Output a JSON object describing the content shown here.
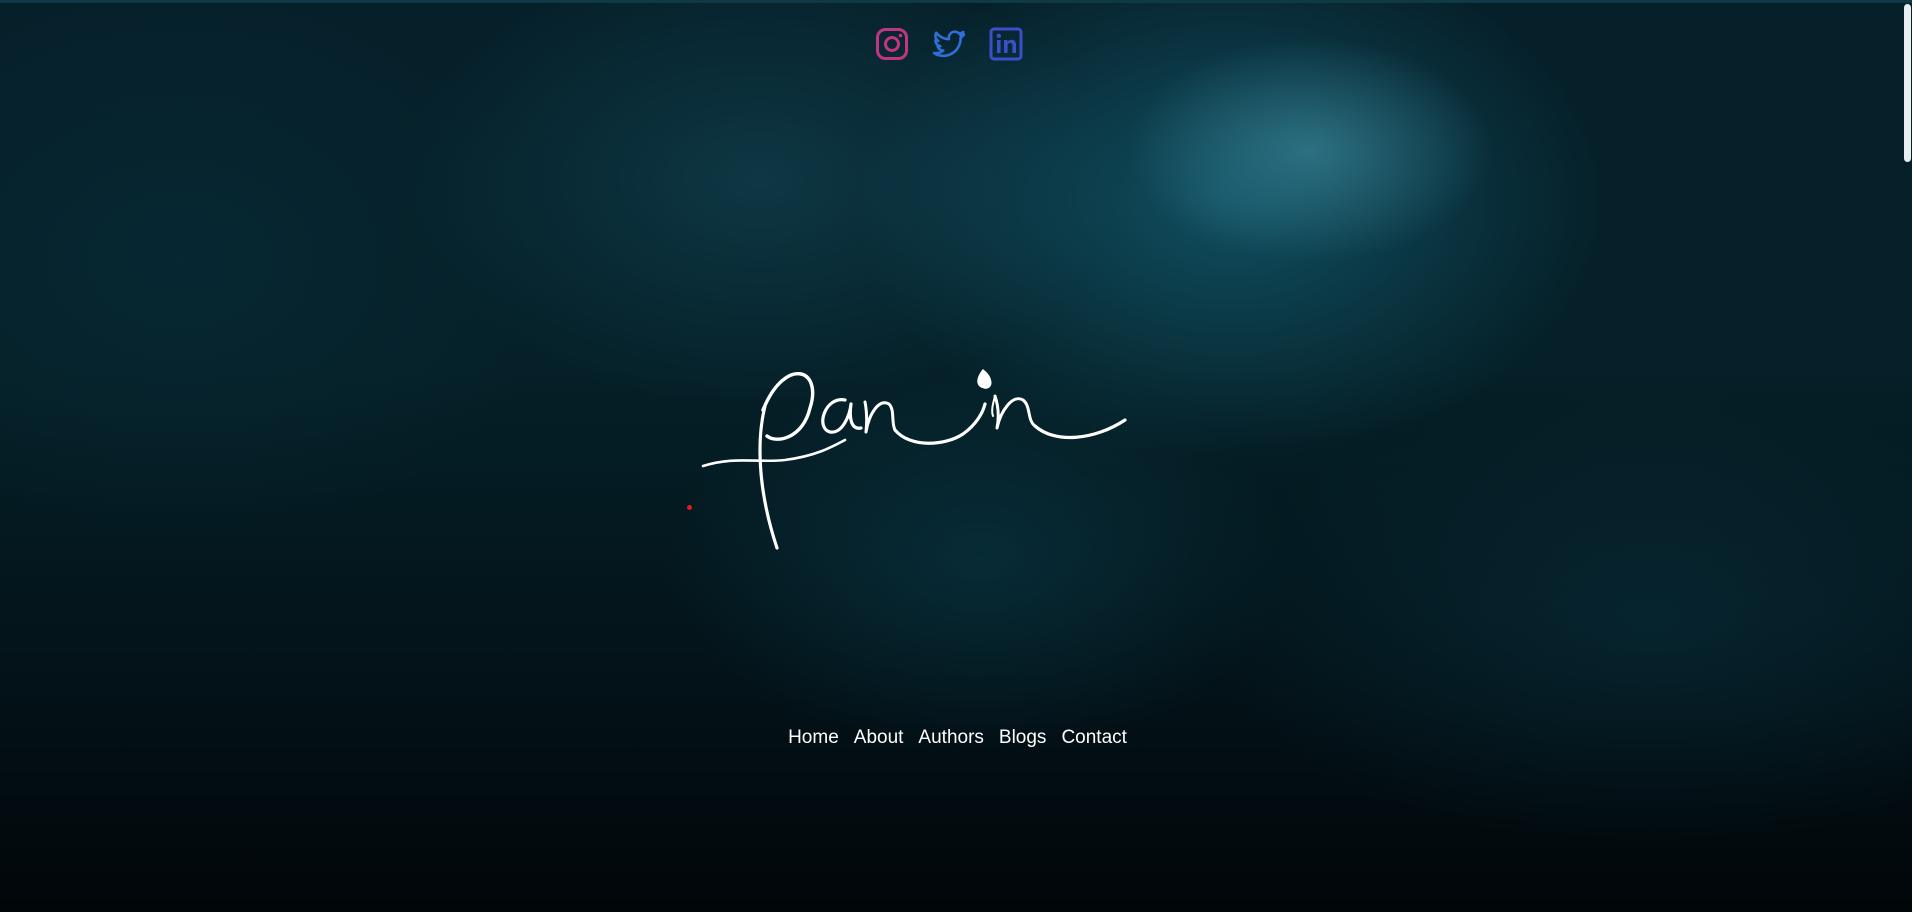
{
  "brand": {
    "logo_text": "panin",
    "logo_color": "#ffffff"
  },
  "social": [
    {
      "name": "instagram",
      "icon": "instagram-icon",
      "color": "#c13584"
    },
    {
      "name": "twitter",
      "icon": "twitter-icon",
      "color": "#2f6fd6"
    },
    {
      "name": "linkedin",
      "icon": "linkedin-icon",
      "color": "#3a4fc9"
    }
  ],
  "nav": {
    "items": [
      "Home",
      "About",
      "Authors",
      "Blogs",
      "Contact"
    ]
  },
  "colors": {
    "accent_dot": "#e01b24",
    "nav_text": "#ffffff"
  }
}
